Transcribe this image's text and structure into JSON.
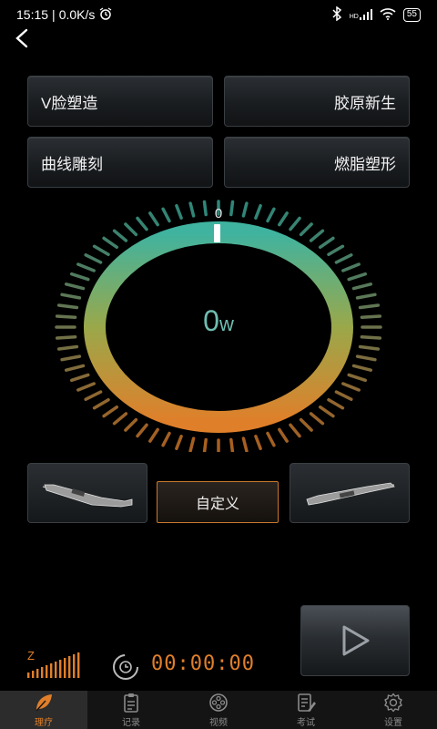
{
  "status_bar": {
    "time": "15:15",
    "network_speed": "0.0K/s",
    "battery": "55",
    "signal_label": "HD"
  },
  "modes": {
    "v_face": "V脸塑造",
    "collagen": "胶原新生",
    "curve": "曲线雕刻",
    "fat_burn": "燃脂塑形"
  },
  "gauge": {
    "zero_label": "0",
    "value": "0",
    "unit": "w",
    "level": 0
  },
  "custom_label": "自定义",
  "timer": "00:00:00",
  "signal": {
    "label": "Z"
  },
  "tabs": [
    {
      "label": "理疗",
      "icon": "leaf-icon",
      "active": true
    },
    {
      "label": "记录",
      "icon": "clipboard-icon",
      "active": false
    },
    {
      "label": "视频",
      "icon": "video-icon",
      "active": false
    },
    {
      "label": "考试",
      "icon": "exam-icon",
      "active": false
    },
    {
      "label": "设置",
      "icon": "gear-icon",
      "active": false
    }
  ],
  "colors": {
    "accent_orange": "#e07f2a",
    "teal": "#3fb3a0",
    "gauge_value": "#6fbdb0"
  }
}
